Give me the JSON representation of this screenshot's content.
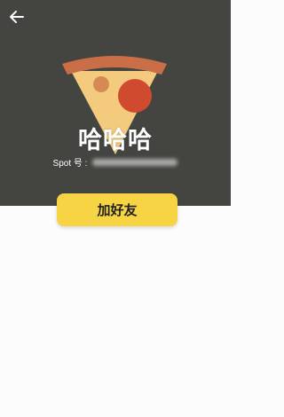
{
  "header": {
    "background_color": "#444441",
    "back_icon": "arrow-left-icon",
    "avatar_icon": "pizza-slice-icon"
  },
  "profile": {
    "name": "哈哈哈",
    "spot_label": "Spot 号 :",
    "spot_value_hidden": true
  },
  "actions": {
    "add_friend_label": "加好友",
    "add_friend_color": "#f7d443"
  }
}
